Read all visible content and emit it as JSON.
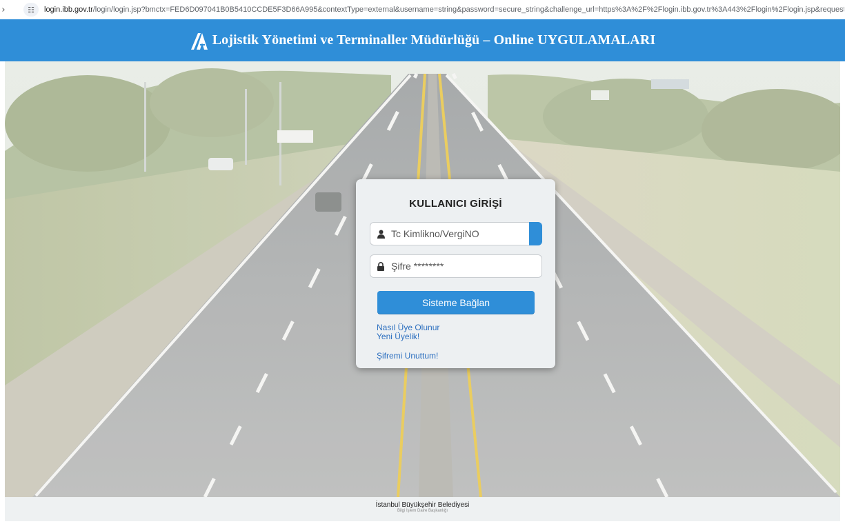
{
  "browser": {
    "url_host": "login.ibb.gov.tr",
    "url_rest": "/login/login.jsp?bmctx=FED6D097041B0B5410CCDE5F3D66A995&contextType=external&username=string&password=secure_string&challenge_url=https%3A%2F%2Flogin.ibb.gov.tr%3A443%2Flogin%2Flogin.jsp&request_id=-722733",
    "site_info_icon": "tune-icon"
  },
  "header": {
    "title": "Lojistik Yönetimi ve Terminaller Müdürlüğü – Online UYGULAMALARI",
    "bg_color": "#2f8ed8"
  },
  "login": {
    "title": "KULLANICI GİRİŞİ",
    "user_placeholder": "Tc Kimlikno/VergiNO",
    "user_icon": "user-icon",
    "password_placeholder": "Şifre ********",
    "password_icon": "lock-icon",
    "submit_label": "Sisteme Bağlan",
    "links": {
      "how_to_register": "Nasıl Üye Olunur",
      "new_membership": "Yeni Üyelik!",
      "forgot_password": "Şifremi Unuttum!"
    },
    "accent_color": "#2f8ed8",
    "link_color": "#2c6fbf"
  },
  "footer": {
    "line1": "İstanbul Büyükşehir Belediyesi",
    "line2": "Bilgi İşlem Daire Başkanlığı"
  }
}
